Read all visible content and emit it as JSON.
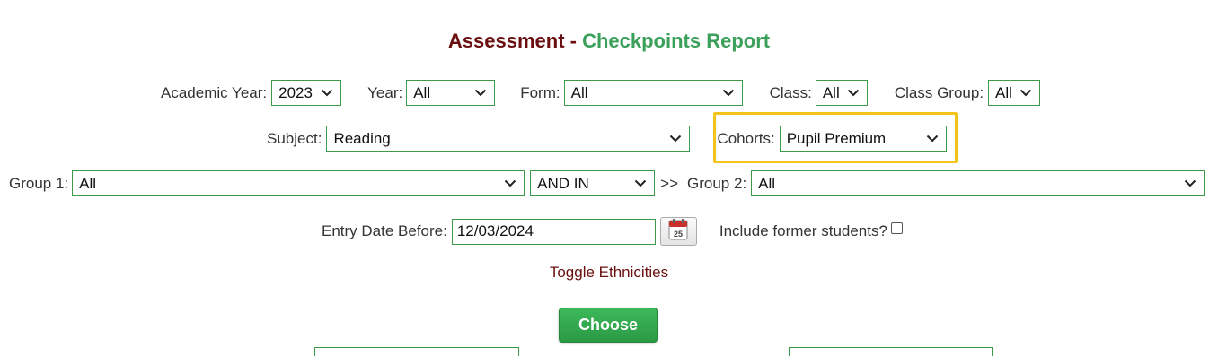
{
  "title": {
    "part1": "Assessment - ",
    "part2": "Checkpoints Report"
  },
  "filters": {
    "academic_year": {
      "label": "Academic Year:",
      "value": "2023"
    },
    "year": {
      "label": "Year:",
      "value": "All"
    },
    "form": {
      "label": "Form:",
      "value": "All"
    },
    "class": {
      "label": "Class:",
      "value": "All"
    },
    "class_group": {
      "label": "Class Group:",
      "value": "All"
    },
    "subject": {
      "label": "Subject:",
      "value": "Reading"
    },
    "cohorts": {
      "label": "Cohorts:",
      "value": "Pupil Premium"
    },
    "group1": {
      "label": "Group 1:",
      "value": "All"
    },
    "operator": {
      "value": "AND IN"
    },
    "arrow": ">>",
    "group2": {
      "label": "Group 2:",
      "value": "All"
    },
    "entry_date": {
      "label": "Entry Date Before:",
      "value": "12/03/2024"
    },
    "calendar_day": "25",
    "include_former": {
      "label": "Include former students?"
    }
  },
  "toggle_ethnicities": "Toggle Ethnicities",
  "choose_button": "Choose",
  "colors": {
    "accent_green": "#3aa05a",
    "title_maroon": "#6a0f0f",
    "highlight": "#f2c318"
  }
}
